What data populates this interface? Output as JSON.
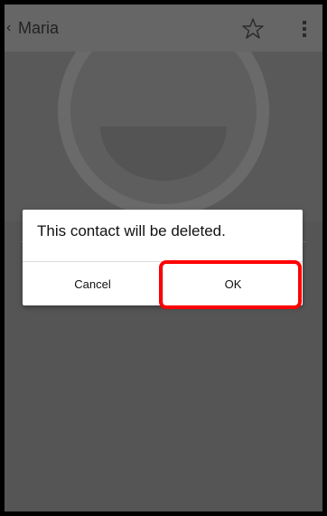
{
  "app_bar": {
    "back_glyph": "‹",
    "title": "Maria",
    "star_icon": "star-outline-icon",
    "menu_icon": "overflow-menu-icon"
  },
  "photo": {
    "placeholder_icon": "default-contact-avatar-icon"
  },
  "dialog": {
    "message": "This contact will be deleted.",
    "cancel_label": "Cancel",
    "ok_label": "OK"
  },
  "colors": {
    "scrim": "#555555",
    "dialog_bg": "#ffffff",
    "highlight": "#ff0000"
  }
}
